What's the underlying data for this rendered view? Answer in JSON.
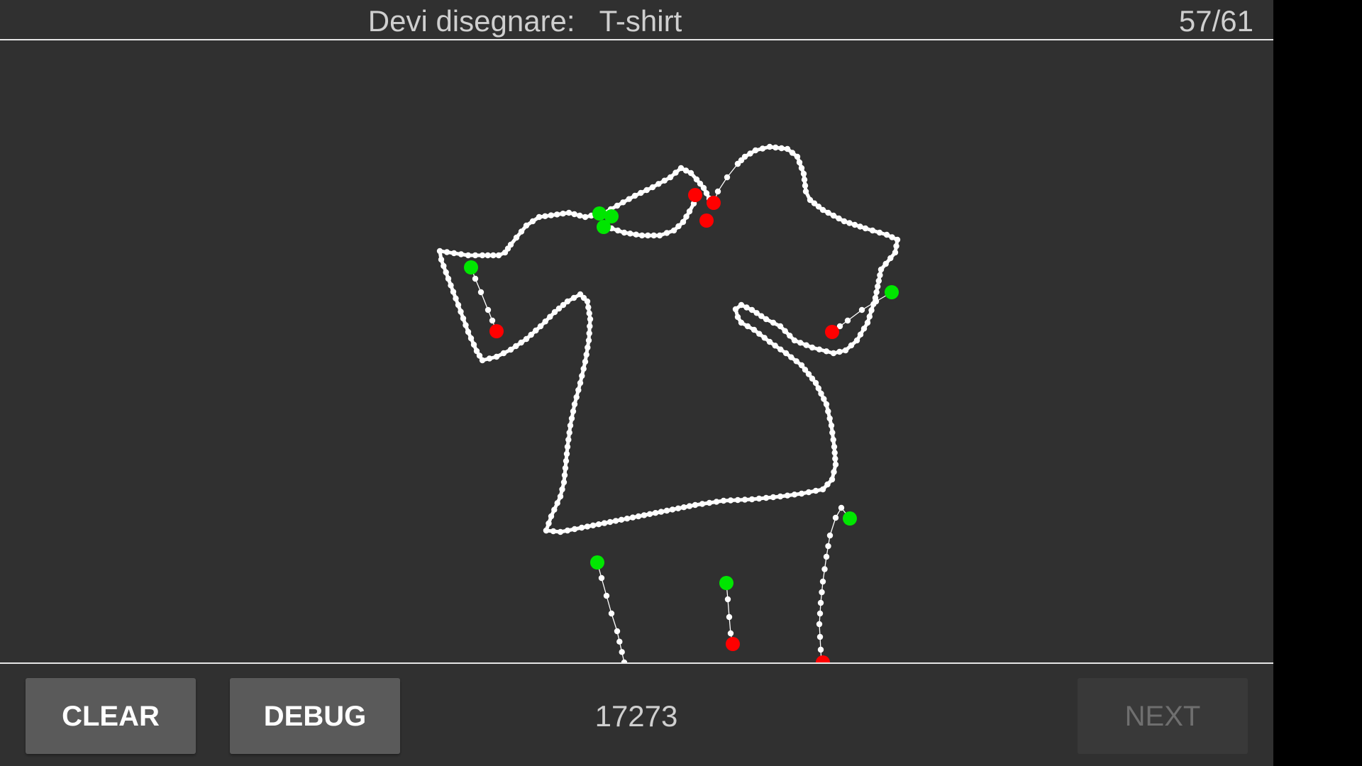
{
  "header": {
    "prompt_label": "Devi disegnare:",
    "target_word": "T-shirt",
    "progress": "57/61"
  },
  "canvas": {
    "stroke_color": "#ffffff",
    "start_marker_color": "#00e600",
    "end_marker_color": "#ff0000"
  },
  "footer": {
    "clear_label": "CLEAR",
    "debug_label": "DEBUG",
    "score": "17273",
    "next_label": "NEXT",
    "next_enabled": false
  },
  "colors": {
    "background": "#303030",
    "button": "#5a5a5a",
    "button_disabled": "#393939",
    "divider": "#e6e6e6"
  }
}
